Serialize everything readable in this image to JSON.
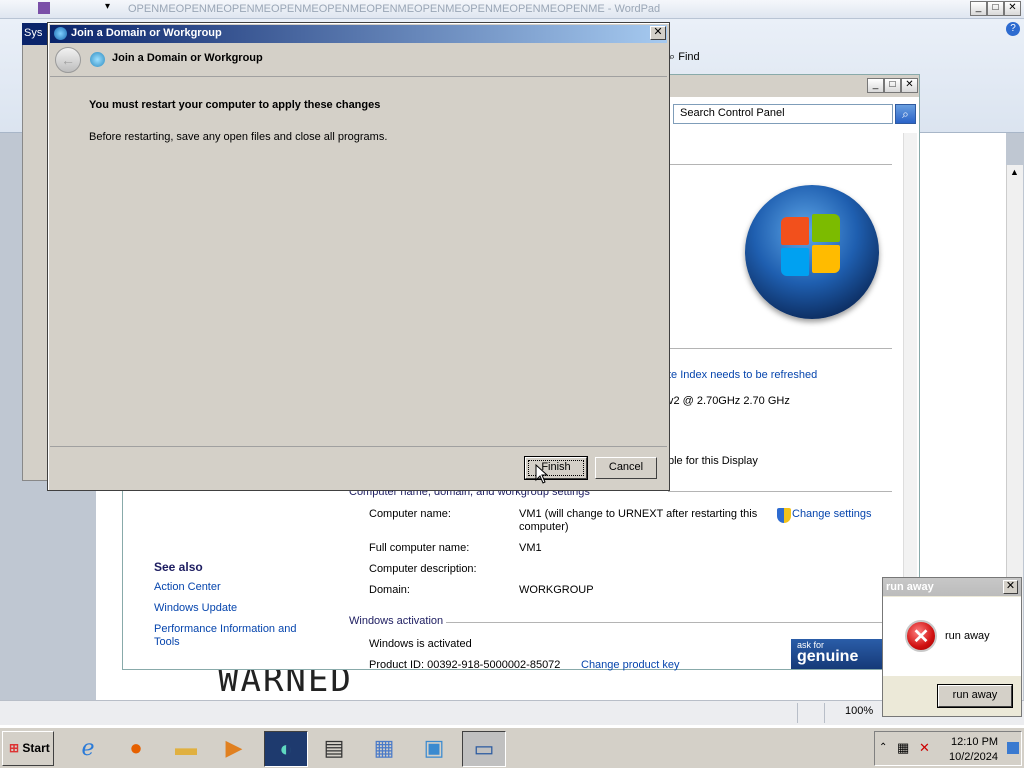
{
  "wordpad": {
    "title": "OPENMEOPENMEOPENMEOPENMEOPENMEOPENMEOPENMEOPENMEOPENMEOPENME - WordPad",
    "find_label": "Find",
    "zoom": "100%",
    "doc_text": "WARNED",
    "minimize": "_",
    "maximize": "□",
    "close": "✕",
    "quick_access_arrow": "▾"
  },
  "system_window": {
    "title": "Sys"
  },
  "control_panel": {
    "search_placeholder": "Search Control Panel",
    "index_refresh": "te Index needs to be refreshed",
    "processor": "v2 @ 2.70GHz   2.70 GHz",
    "display": "ble for this Display",
    "section_name": "Computer name, domain, and workgroup settings",
    "computer_name_label": "Computer name:",
    "computer_name_value": "VM1 (will change to URNEXT after restarting this",
    "computer_name_value2": "computer)",
    "change_settings": "Change settings",
    "full_name_label": "Full computer name:",
    "full_name_value": "VM1",
    "description_label": "Computer description:",
    "domain_label": "Domain:",
    "domain_value": "WORKGROUP",
    "see_also": "See also",
    "action_center": "Action Center",
    "windows_update": "Windows Update",
    "perf_info": "Performance Information and",
    "perf_info2": "Tools",
    "activation_section": "Windows activation",
    "activated": "Windows is activated",
    "product_id": "Product ID: 00392-918-5000002-85072",
    "change_product_key": "Change product key",
    "genuine_top": "ask for",
    "genuine_bottom": "genuine"
  },
  "dialog": {
    "title": "Join a Domain or Workgroup",
    "header_title": "Join a Domain or Workgroup",
    "heading": "You must restart your computer to apply these changes",
    "body": "Before restarting, save any open files and close all programs.",
    "finish": "Finish",
    "cancel": "Cancel",
    "close": "✕",
    "back": "←"
  },
  "popup": {
    "title": "run away",
    "message": "run away",
    "button": "run away",
    "close": "✕",
    "icon": "✕"
  },
  "taskbar": {
    "start": "Start",
    "time": "12:10 PM",
    "date": "10/2/2024",
    "apps": [
      "internet-explorer-icon",
      "firefox-icon",
      "folder-icon",
      "media-player-icon",
      "active-app-icon",
      "notepad-icon",
      "wordpad-icon",
      "control-panel-icon",
      "computer-icon"
    ]
  }
}
